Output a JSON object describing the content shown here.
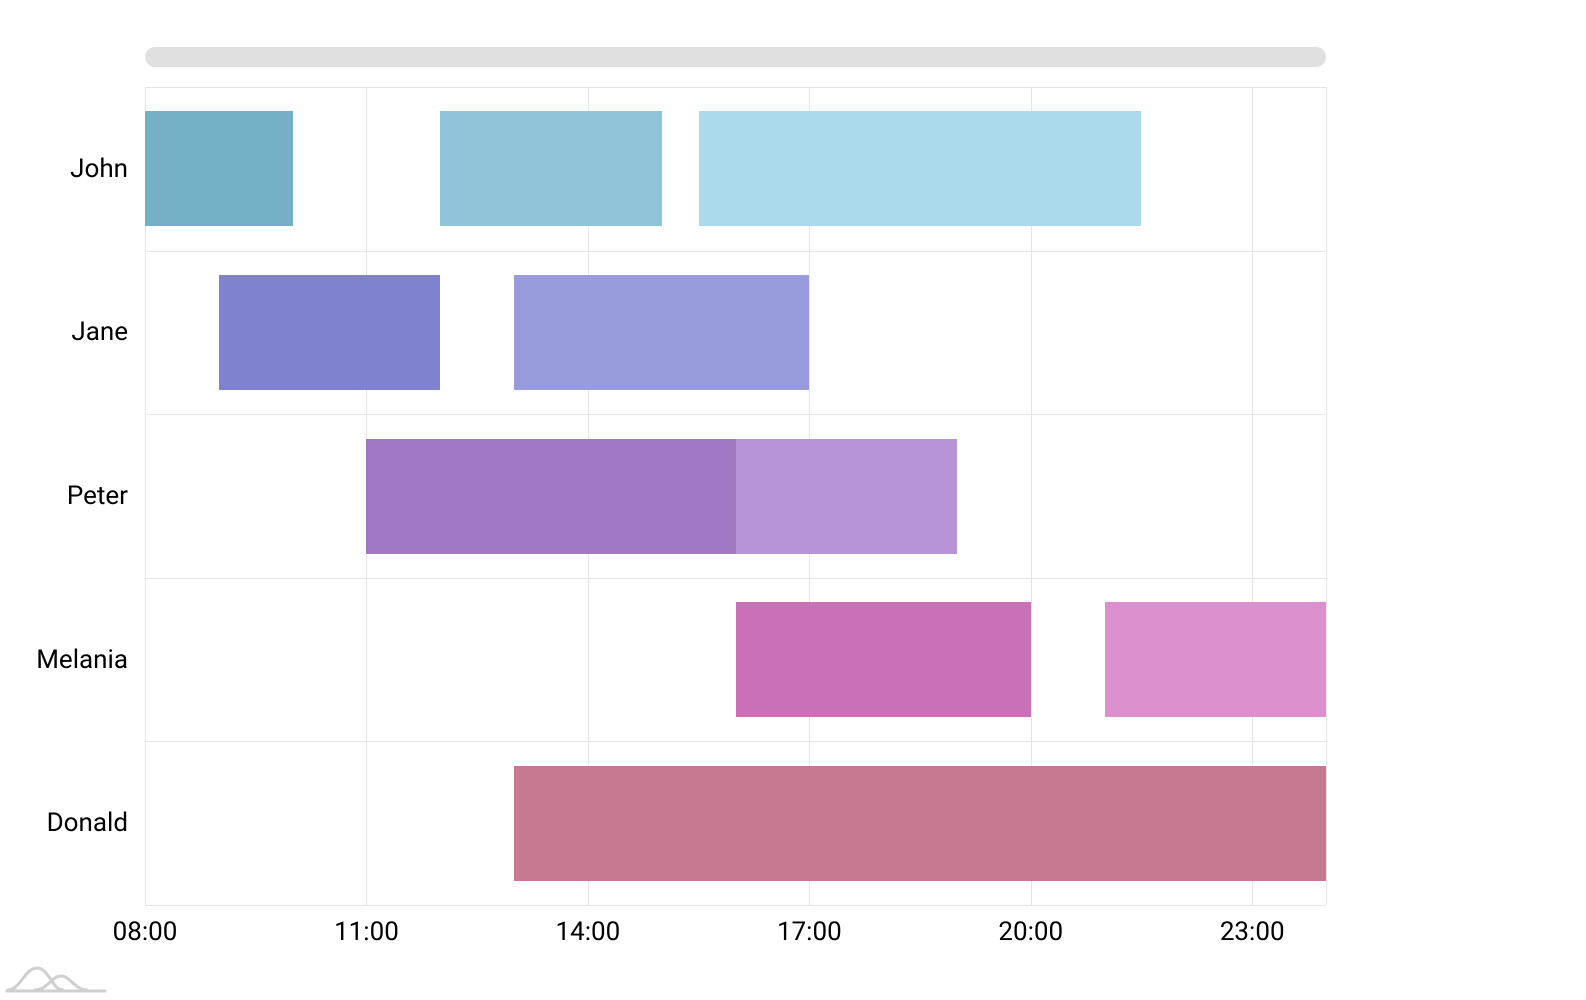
{
  "chart_data": {
    "type": "gantt",
    "x_axis": {
      "ticks": [
        "08:00",
        "11:00",
        "14:00",
        "17:00",
        "20:00",
        "23:00"
      ],
      "range_h": [
        8,
        24
      ]
    },
    "categories": [
      "John",
      "Jane",
      "Peter",
      "Melania",
      "Donald"
    ],
    "series": [
      {
        "category": "John",
        "start_h": 8.0,
        "end_h": 10.0,
        "color": "#75b0c7"
      },
      {
        "category": "John",
        "start_h": 12.0,
        "end_h": 15.0,
        "color": "#8fc4d9"
      },
      {
        "category": "John",
        "start_h": 15.5,
        "end_h": 21.5,
        "color": "#abdaec"
      },
      {
        "category": "Jane",
        "start_h": 9.0,
        "end_h": 12.0,
        "color": "#7f82ce"
      },
      {
        "category": "Jane",
        "start_h": 13.0,
        "end_h": 17.0,
        "color": "#999cdc"
      },
      {
        "category": "Peter",
        "start_h": 11.0,
        "end_h": 16.0,
        "color": "#a077c2"
      },
      {
        "category": "Peter",
        "start_h": 16.0,
        "end_h": 19.0,
        "color": "#b893d6"
      },
      {
        "category": "Melania",
        "start_h": 16.0,
        "end_h": 20.0,
        "color": "#c971b7"
      },
      {
        "category": "Melania",
        "start_h": 21.0,
        "end_h": 24.0,
        "color": "#dc90cd"
      },
      {
        "category": "Donald",
        "start_h": 13.0,
        "end_h": 24.0,
        "color": "#c67991"
      }
    ]
  }
}
